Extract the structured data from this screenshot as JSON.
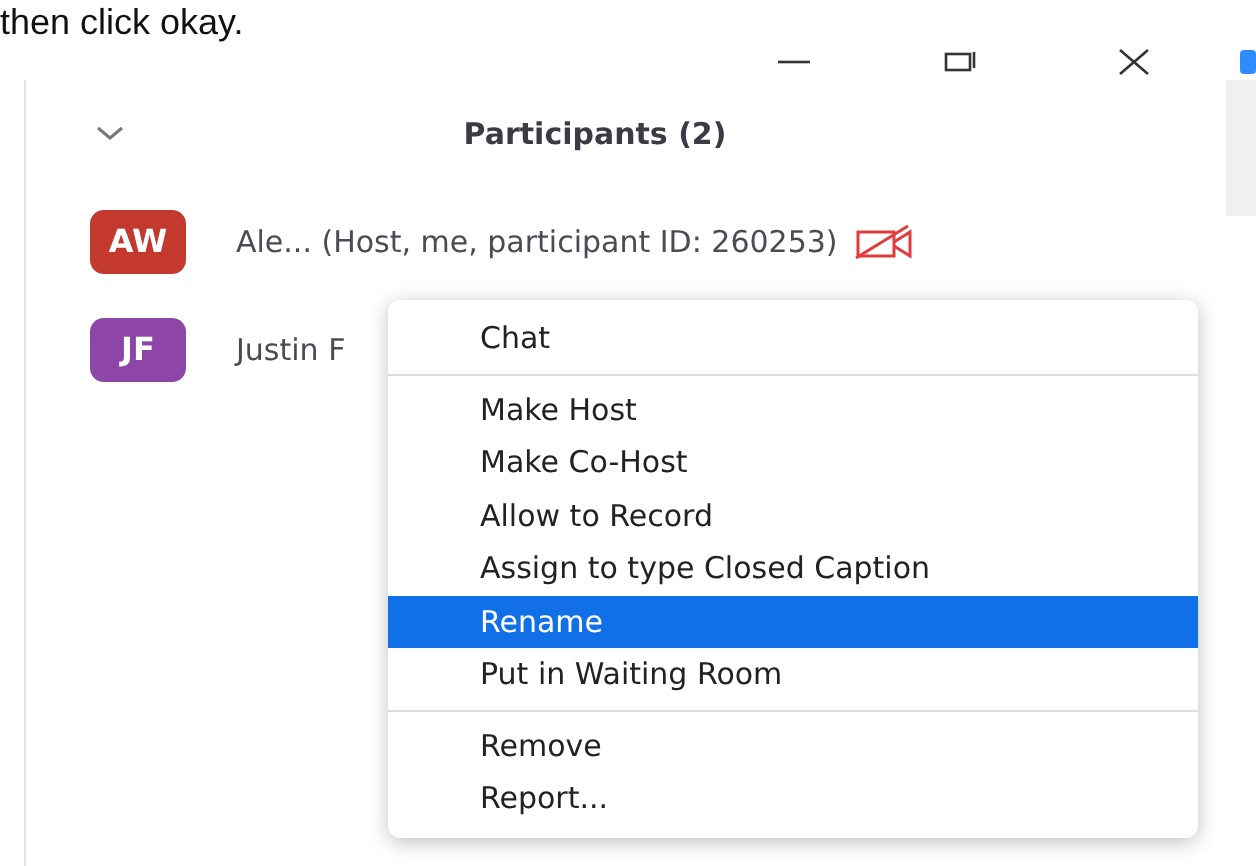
{
  "caption": "then click okay.",
  "panel": {
    "title": "Participants (2)"
  },
  "participants": [
    {
      "initials": "AW",
      "color": "#c3392d",
      "name": "Ale... (Host, me, participant ID: 260253)",
      "video_off": true
    },
    {
      "initials": "JF",
      "color": "#8e45a8",
      "name": "Justin F",
      "video_off": false
    }
  ],
  "context_menu": {
    "groups": [
      [
        {
          "label": "Chat",
          "selected": false
        }
      ],
      [
        {
          "label": "Make Host",
          "selected": false
        },
        {
          "label": "Make Co-Host",
          "selected": false
        },
        {
          "label": "Allow to Record",
          "selected": false
        },
        {
          "label": "Assign to type Closed Caption",
          "selected": false
        },
        {
          "label": "Rename",
          "selected": true
        },
        {
          "label": "Put in Waiting Room",
          "selected": false
        }
      ],
      [
        {
          "label": "Remove",
          "selected": false
        },
        {
          "label": "Report...",
          "selected": false
        }
      ]
    ]
  }
}
